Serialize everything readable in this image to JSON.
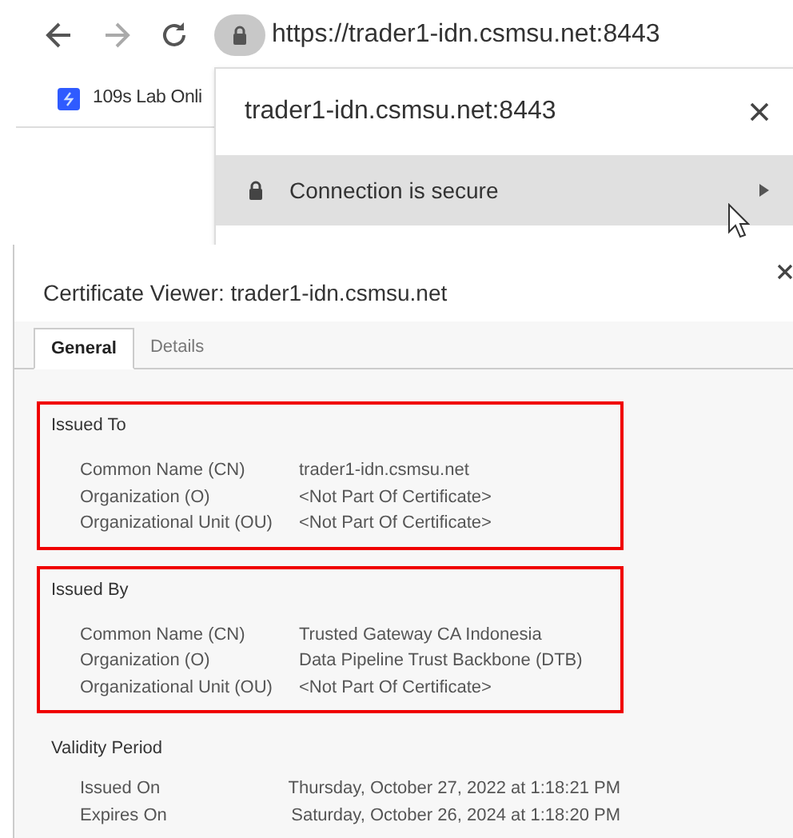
{
  "address_bar": {
    "url": "https://trader1-idn.csmsu.net:8443"
  },
  "bookmarks": [
    {
      "label": "109s Lab Onli"
    }
  ],
  "site_popup": {
    "host": "trader1-idn.csmsu.net:8443",
    "rows": [
      {
        "label": "Connection is secure",
        "hovered": true
      }
    ]
  },
  "certificate_viewer": {
    "title": "Certificate Viewer: trader1-idn.csmsu.net",
    "tabs": [
      {
        "label": "General",
        "selected": true
      },
      {
        "label": "Details",
        "selected": false
      }
    ],
    "sections": [
      {
        "title": "Issued To",
        "highlighted": true,
        "fields": [
          {
            "label": "Common Name (CN)",
            "value": "trader1-idn.csmsu.net"
          },
          {
            "label": "Organization (O)",
            "value": "<Not Part Of Certificate>"
          },
          {
            "label": "Organizational Unit (OU)",
            "value": "<Not Part Of Certificate>"
          }
        ]
      },
      {
        "title": "Issued By",
        "highlighted": true,
        "fields": [
          {
            "label": "Common Name (CN)",
            "value": "Trusted Gateway CA Indonesia"
          },
          {
            "label": "Organization (O)",
            "value": "Data Pipeline Trust Backbone (DTB)"
          },
          {
            "label": "Organizational Unit (OU)",
            "value": "<Not Part Of Certificate>"
          }
        ]
      },
      {
        "title": "Validity Period",
        "highlighted": false,
        "fields": [
          {
            "label": "Issued On",
            "value": "Thursday, October 27, 2022 at 1:18:21 PM"
          },
          {
            "label": "Expires On",
            "value": "Saturday, October 26, 2024 at 1:18:20 PM"
          }
        ]
      }
    ]
  }
}
